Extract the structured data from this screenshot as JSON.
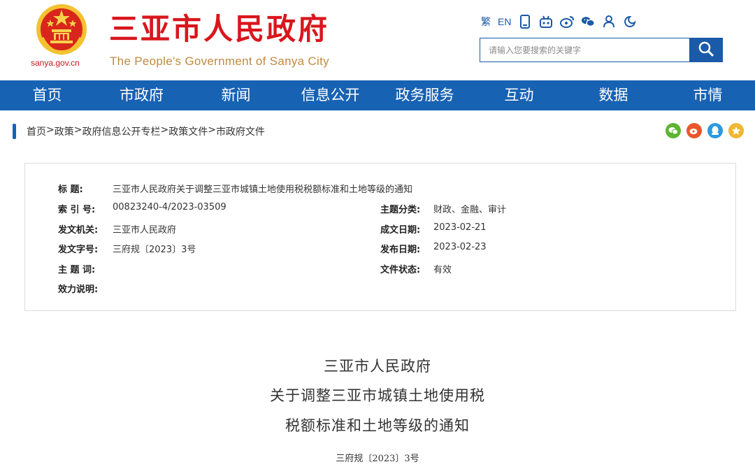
{
  "header": {
    "domain": "sanya.gov.cn",
    "title": "三亚市人民政府",
    "subtitle": "The People's Government of Sanya City",
    "toolbar": {
      "traditional": "繁",
      "english": "EN"
    },
    "search": {
      "placeholder": "请输入您要搜索的关键字"
    }
  },
  "nav": {
    "items": [
      "首页",
      "市政府",
      "新闻",
      "信息公开",
      "政务服务",
      "互动",
      "数据",
      "市情"
    ]
  },
  "breadcrumb": {
    "items": [
      "首页",
      ">",
      "政策",
      ">",
      "政府信息公开专栏",
      ">",
      "政策文件",
      ">",
      "市政府文件"
    ]
  },
  "info": {
    "title_label": "标 题:",
    "title_value": "三亚市人民政府关于调整三亚市城镇土地使用税税额标准和土地等级的通知",
    "index_label": "索 引 号:",
    "index_value": "00823240-4/2023-03509",
    "category_label": "主题分类:",
    "category_value": "财政、金融、审计",
    "issuer_label": "发文机关:",
    "issuer_value": "三亚市人民政府",
    "written_label": "成文日期:",
    "written_value": "2023-02-21",
    "docno_label": "发文字号:",
    "docno_value": "三府规〔2023〕3号",
    "published_label": "发布日期:",
    "published_value": "2023-02-23",
    "keywords_label": "主 题 词:",
    "keywords_value": "",
    "status_label": "文件状态:",
    "status_value": "有效",
    "validity_label": "效力说明:",
    "validity_value": ""
  },
  "document": {
    "title_line1": "三亚市人民政府",
    "title_line2": "关于调整三亚市城镇土地使用税",
    "title_line3": "税额标准和土地等级的通知",
    "number": "三府规〔2023〕3号"
  },
  "colors": {
    "brand_blue": "#1862b3",
    "title_red": "#d9161d",
    "subtitle_gold": "#c08a3e"
  }
}
